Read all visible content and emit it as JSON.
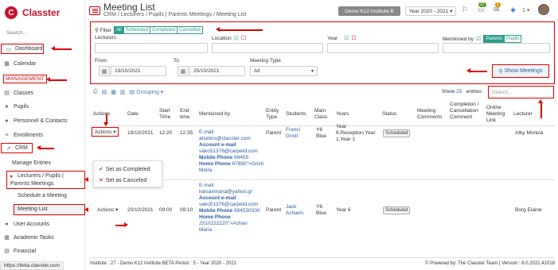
{
  "app": {
    "logo_mark": "C",
    "name": "Classter"
  },
  "sidebar": {
    "search_placeholder": "Search...",
    "dashboard": "Dashboard",
    "calendar": "Calendar",
    "management_label": "MANAGEMENT",
    "classes": "Classes",
    "pupils": "Pupils",
    "personnel": "Personnel & Contacts",
    "enrollments": "Enrollments",
    "crm": "CRM",
    "manage_entries": "Manage Entries",
    "lecturers_line1": "Lecturers / Pupils |",
    "lecturers_line2": "Parents Meetings",
    "schedule_meeting": "Schedule a Meeting",
    "meeting_list": "Meeting List",
    "user_accounts": "User Accounts",
    "academic_tasks": "Academic Tasks",
    "financial": "Financial"
  },
  "status_url": "https://beta.classter.com",
  "header": {
    "title": "Meeting List",
    "breadcrumb": "CRM  /  Lecturers / Pupils | Parents Meetings  /  Meeting List",
    "institute": "Demo K12 Institute B",
    "year": "Year 2020 - 2021  ▾",
    "badge_msgs": "27",
    "badge_notif": "5",
    "page_num": "1 ▾"
  },
  "filter": {
    "title": "Filter",
    "seg": [
      "All",
      "Scheduled",
      "Completed",
      "Cancelled"
    ],
    "lecturers_label": "Lecturers",
    "location_label": "Location",
    "year_label": "Year",
    "mentioned_label": "Mentioned by",
    "mentioned_seg": [
      "Parents",
      "Pupils"
    ],
    "from_label": "From",
    "from_value": "19/10/2021",
    "to_label": "To",
    "to_value": "25/10/2021",
    "type_label": "Meeting Type",
    "type_value": "All",
    "show_button": "Show Meetings"
  },
  "toolbar": {
    "grouping": "Grouping ▾"
  },
  "entries": {
    "show": "Show",
    "count": "25",
    "label": "entries"
  },
  "search": {
    "placeholder": "Search..."
  },
  "table": {
    "headers": {
      "actions": "Actions",
      "date": "Date",
      "start1": "Start",
      "start2": "Time",
      "end1": "End",
      "end2": "time",
      "mentioned": "Mentioned by",
      "entity1": "Entity",
      "entity2": "Type",
      "students": "Students",
      "main1": "Main",
      "main2": "Class",
      "years": "Years",
      "status": "Status",
      "comments1": "Meeting",
      "comments2": "Comments",
      "completion1": "Completion /",
      "completion2": "Cancellation",
      "completion3": "Comment",
      "online1": "Online",
      "online2": "Meeting",
      "online3": "Link",
      "lecturer": "Lecturer"
    },
    "rows": [
      {
        "actions": "Actions ▾",
        "date": "19/10/2021",
        "start": "12:20",
        "end": "12:35",
        "email_label": "E-mail",
        "email": "atselios@classter.com",
        "acct_label": "Account e-mail",
        "acct": "vako51376@carpetd.com",
        "mobile_label": "Mobile Phone",
        "mobile": "69455",
        "home_label": "Home Phone",
        "home": "67890\">Grixti",
        "home2": "Moira",
        "entity": "Parent",
        "student1": "Franci",
        "student2": "Grixti",
        "class1": "Y6",
        "class2": "Blue",
        "years1": "Year",
        "years2": "6,Reception,Year",
        "years3": "1,Year 1",
        "status": "Scheduled",
        "lecturer": "Alby Monica"
      },
      {
        "actions": "Actions ▾",
        "date": "20/10/2021",
        "start": "09:00",
        "end": "09:10",
        "email_label": "E-mail",
        "email": "katsaninana@yahoo.gr",
        "acct_label": "Account e-mail",
        "acct": "vako51376@carpetd.com",
        "mobile_label": "Mobile Phone",
        "mobile": "694530330",
        "home_label": "Home Phone",
        "home": "2510222220\">Achan",
        "home2": "Maria",
        "entity": "Parent",
        "student1": "Jack",
        "student2": "Achann",
        "class1": "Y6",
        "class2": "Blue",
        "years1": "Year 6",
        "status": "Scheduled",
        "lecturer": "Borg Elaine"
      }
    ]
  },
  "dropdown": {
    "completed": "Set as Completed",
    "canceled": "Set as Canceled"
  },
  "footer": {
    "left": "Institute : 27 - Demo K12 Institute BETA  Period : 5 - Year 2020 - 2021",
    "powered": "Powered by: The Classter Team",
    "version": "Version : 6.0.2021.41018"
  }
}
